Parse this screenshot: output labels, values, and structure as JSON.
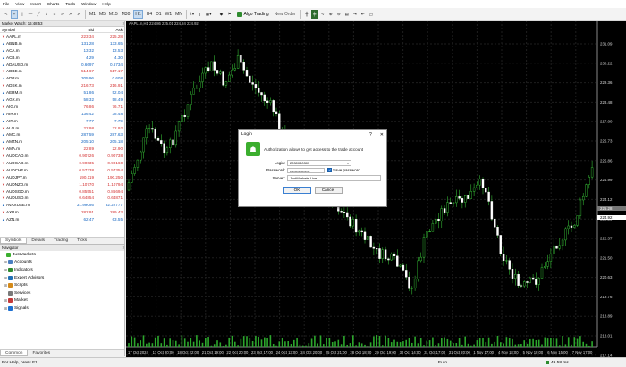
{
  "menu": [
    "File",
    "View",
    "Insert",
    "Charts",
    "Tools",
    "Window",
    "Help"
  ],
  "toolbar": {
    "timeframes": [
      "M1",
      "M5",
      "M15",
      "M30",
      "H1",
      "H4",
      "D1",
      "W1",
      "MN"
    ],
    "active_timeframe": "H1",
    "algo_label": "Algo Trading",
    "new_order_label": "New Order"
  },
  "market_watch": {
    "title": "Market Watch: 16:48:53",
    "headers": {
      "symbol": "Symbol",
      "bid": "Bid",
      "ask": "Ask"
    },
    "rows": [
      {
        "symbol": "AAPL.m",
        "bid": "223.34",
        "ask": "225.28",
        "dir": "down"
      },
      {
        "symbol": "ABNB.m",
        "bid": "131.28",
        "ask": "133.65",
        "dir": "up"
      },
      {
        "symbol": "ACA.m",
        "bid": "13.32",
        "ask": "13.53",
        "dir": "up"
      },
      {
        "symbol": "ACB.m",
        "bid": "4.29",
        "ask": "4.30",
        "dir": "up"
      },
      {
        "symbol": "ADAUSD.m",
        "bid": "0.6697",
        "ask": "0.6734",
        "dir": "up"
      },
      {
        "symbol": "ADBE.m",
        "bid": "514.67",
        "ask": "517.17",
        "dir": "down"
      },
      {
        "symbol": "ADP.m",
        "bid": "305.96",
        "ask": "0.608",
        "dir": "up"
      },
      {
        "symbol": "ADSK.m",
        "bid": "216.73",
        "ask": "216.91",
        "dir": "down"
      },
      {
        "symbol": "AERM.m",
        "bid": "51.86",
        "ask": "52.04",
        "dir": "up"
      },
      {
        "symbol": "AGX.m",
        "bid": "58.32",
        "ask": "58.49",
        "dir": "up"
      },
      {
        "symbol": "AIG.m",
        "bid": "76.86",
        "ask": "76.71",
        "dir": "down"
      },
      {
        "symbol": "AIR.m",
        "bid": "136.42",
        "ask": "38.48",
        "dir": "up"
      },
      {
        "symbol": "AIR.m",
        "bid": "7.77",
        "ask": "7.79",
        "dir": "up"
      },
      {
        "symbol": "ALO.m",
        "bid": "22.98",
        "ask": "22.92",
        "dir": "down"
      },
      {
        "symbol": "AMC.m",
        "bid": "287.59",
        "ask": "287.63",
        "dir": "up"
      },
      {
        "symbol": "AMZN.m",
        "bid": "205.10",
        "ask": "205.18",
        "dir": "up"
      },
      {
        "symbol": "AMA.m",
        "bid": "22.89",
        "ask": "22.90",
        "dir": "down"
      },
      {
        "symbol": "AUDCAD.m",
        "bid": "0.90726",
        "ask": "0.90738",
        "dir": "down"
      },
      {
        "symbol": "AUDCAD.m",
        "bid": "0.90035",
        "ask": "0.90160",
        "dir": "down"
      },
      {
        "symbol": "AUDCHF.m",
        "bid": "0.57338",
        "ask": "0.57354",
        "dir": "down"
      },
      {
        "symbol": "AUDJPY.m",
        "bid": "190.119",
        "ask": "190.250",
        "dir": "down"
      },
      {
        "symbol": "AUDNZD.m",
        "bid": "1.10770",
        "ask": "1.10794",
        "dir": "down"
      },
      {
        "symbol": "AUDSGD.m",
        "bid": "0.85551",
        "ask": "0.86694",
        "dir": "down"
      },
      {
        "symbol": "AUDUSD.m",
        "bid": "0.64854",
        "ask": "0.64871",
        "dir": "down"
      },
      {
        "symbol": "AVAXUSE.m",
        "bid": "31.99095",
        "ask": "32.22777",
        "dir": "up"
      },
      {
        "symbol": "AXP.m",
        "bid": "282.91",
        "ask": "289.43",
        "dir": "down"
      },
      {
        "symbol": "AZN.m",
        "bid": "62.47",
        "ask": "63.55",
        "dir": "up"
      }
    ],
    "tabs": [
      "Symbols",
      "Details",
      "Trading",
      "Ticks"
    ],
    "active_tab": "Symbols"
  },
  "navigator": {
    "title": "Navigator",
    "items": [
      {
        "label": "JustMarkets",
        "color": "#3bae2e",
        "expand": ""
      },
      {
        "label": "Accounts",
        "color": "#4a7fc1",
        "expand": "+"
      },
      {
        "label": "Indicators",
        "color": "#2e8b2e",
        "expand": "+"
      },
      {
        "label": "Expert Advisors",
        "color": "#1f6fb5",
        "expand": "+"
      },
      {
        "label": "Scripts",
        "color": "#d48a1a",
        "expand": "+"
      },
      {
        "label": "Services",
        "color": "#7a7a7a",
        "expand": ""
      },
      {
        "label": "Market",
        "color": "#c43a3a",
        "expand": "+"
      },
      {
        "label": "Signals",
        "color": "#1c6fd1",
        "expand": "+"
      }
    ],
    "tabs": [
      "Common",
      "Favorites"
    ],
    "active_tab": "Common"
  },
  "chart": {
    "info": "AAPL.m,H1 224.86 225.01 224.84 224.92",
    "price_labels": [
      "231.09",
      "230.22",
      "229.36",
      "228.48",
      "227.60",
      "226.73",
      "225.86",
      "224.99",
      "224.12",
      "223.25",
      "222.37",
      "221.50",
      "220.63",
      "219.76",
      "218.89",
      "218.01",
      "217.14"
    ],
    "price_tags": [
      "225.28",
      "224.92"
    ],
    "date_labels": [
      "17 Oct 2024",
      "17 Oct 20:00",
      "18 Oct 22:00",
      "21 Oct 19:00",
      "22 Oct 20:00",
      "23 Oct 17:00",
      "24 Oct 13:00",
      "24 Oct 20:00",
      "25 Oct 21:00",
      "28 Oct 18:00",
      "29 Oct 19:00",
      "30 Oct 14:00",
      "31 Oct 17:00",
      "31 Oct 20:00",
      "1 Nov 17:00",
      "4 Nov 18:00",
      "5 Nov 19:00",
      "6 Nov 15:00",
      "7 Nov 17:00"
    ]
  },
  "dialog": {
    "title": "Login",
    "help": "?",
    "close": "✕",
    "message": "Authorization allows to get access to the trade account",
    "login_label": "Login:",
    "login_value": "2030030303",
    "password_label": "Password:",
    "password_value": "••••••••••••••••",
    "save_password_label": "Save password",
    "server_label": "Server:",
    "server_value": "JustMarkets-Live",
    "ok_label": "OK",
    "cancel_label": "Cancel"
  },
  "status": {
    "help_text": "For Help, press F1",
    "profile": "Euro",
    "ping": "49.58 ms"
  }
}
